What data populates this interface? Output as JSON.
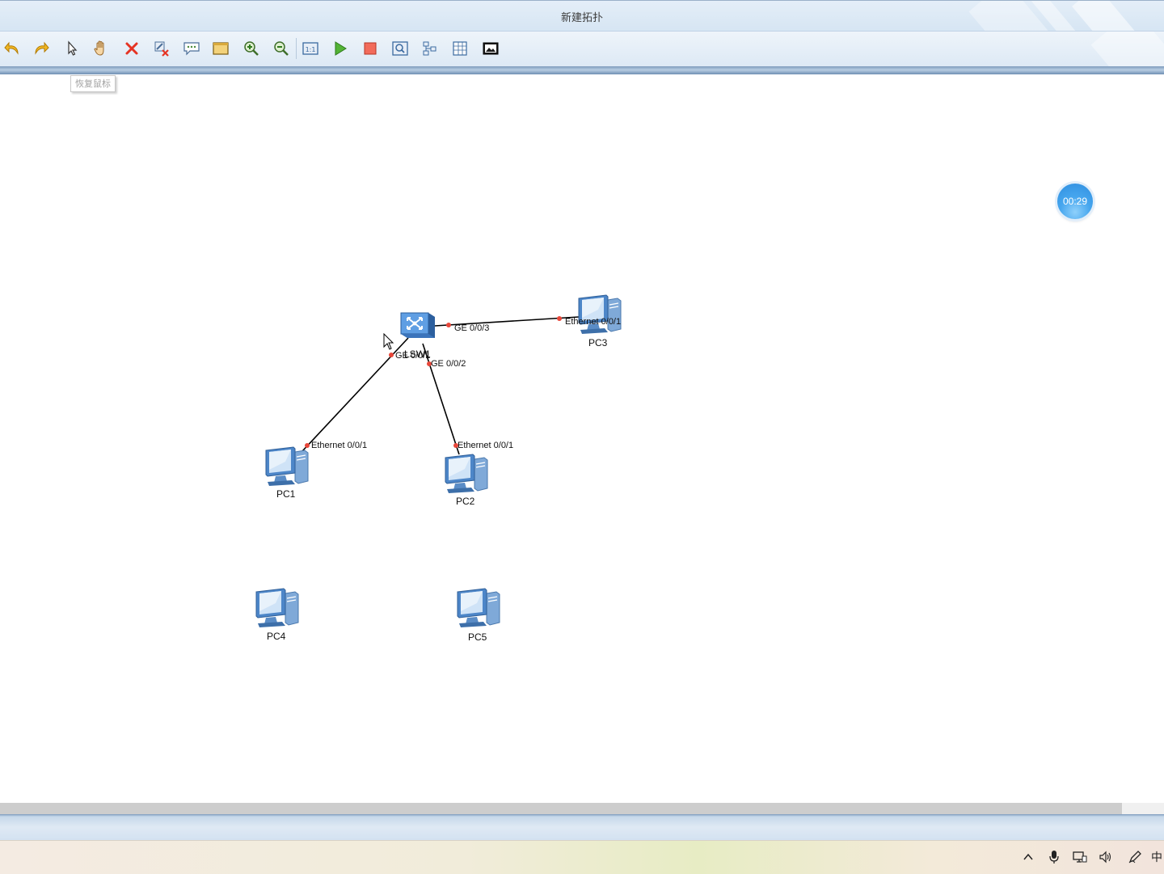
{
  "window": {
    "title": "新建拓扑"
  },
  "toolbar": {
    "buttons": [
      {
        "name": "undo-button",
        "icon": "undo-arrow-icon"
      },
      {
        "name": "redo-button",
        "icon": "redo-arrow-icon"
      },
      {
        "name": "select-button",
        "icon": "pointer-cursor-icon"
      },
      {
        "name": "pan-button",
        "icon": "hand-icon"
      },
      {
        "name": "delete-button",
        "icon": "red-x-icon"
      },
      {
        "name": "delete-link-button",
        "icon": "remove-link-icon"
      },
      {
        "name": "add-text-button",
        "icon": "text-note-icon"
      },
      {
        "name": "palette-button",
        "icon": "palette-icon"
      },
      {
        "name": "zoom-in-button",
        "icon": "zoom-in-icon"
      },
      {
        "name": "zoom-out-button",
        "icon": "zoom-out-icon"
      },
      {
        "name": "fit-view-button",
        "icon": "fit-view-icon"
      },
      {
        "name": "start-device-button",
        "icon": "play-icon"
      },
      {
        "name": "stop-device-button",
        "icon": "stop-icon"
      },
      {
        "name": "capture-button",
        "icon": "capture-icon"
      },
      {
        "name": "topology-button",
        "icon": "topology-icon"
      },
      {
        "name": "grid-button",
        "icon": "grid-icon"
      },
      {
        "name": "screenshot-button",
        "icon": "screenshot-icon"
      }
    ],
    "tooltip": "恢复鼠标"
  },
  "topology": {
    "nodes": [
      {
        "id": "lsw1",
        "label": "LSW1",
        "type": "switch"
      },
      {
        "id": "pc1",
        "label": "PC1",
        "type": "pc"
      },
      {
        "id": "pc2",
        "label": "PC2",
        "type": "pc"
      },
      {
        "id": "pc3",
        "label": "PC3",
        "type": "pc"
      },
      {
        "id": "pc4",
        "label": "PC4",
        "type": "pc"
      },
      {
        "id": "pc5",
        "label": "PC5",
        "type": "pc"
      }
    ],
    "links": [
      {
        "from": "lsw1",
        "from_port": "GE 0/0/1",
        "to": "pc1",
        "to_port": "Ethernet 0/0/1"
      },
      {
        "from": "lsw1",
        "from_port": "GE 0/0/2",
        "to": "pc2",
        "to_port": "Ethernet 0/0/1"
      },
      {
        "from": "lsw1",
        "from_port": "GE 0/0/3",
        "to": "pc3",
        "to_port": "Ethernet 0/0/1"
      }
    ],
    "port_color": "#e8473a",
    "link_color": "#000000"
  },
  "timer": {
    "value": "00:29"
  },
  "taskbar": {
    "tray": [
      {
        "name": "show-hidden-icons",
        "icon": "chevron-up-icon"
      },
      {
        "name": "microphone-tray",
        "icon": "microphone-icon"
      },
      {
        "name": "network-tray",
        "icon": "network-icon"
      },
      {
        "name": "volume-tray",
        "icon": "speaker-icon"
      },
      {
        "name": "pen-tray",
        "icon": "pen-icon"
      },
      {
        "name": "ime-tray",
        "icon": "ime-icon",
        "text": "中"
      }
    ]
  }
}
